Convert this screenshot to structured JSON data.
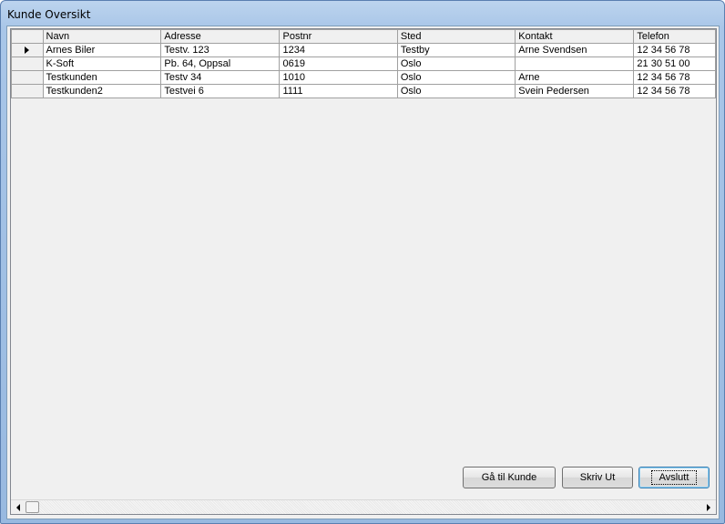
{
  "window": {
    "title": "Kunde Oversikt"
  },
  "grid": {
    "columns": [
      "Navn",
      "Adresse",
      "Postnr",
      "Sted",
      "Kontakt",
      "Telefon"
    ],
    "rows": [
      [
        "Arnes Biler",
        "Testv. 123",
        "1234",
        "Testby",
        "Arne Svendsen",
        "12 34 56 78"
      ],
      [
        "K-Soft",
        "Pb. 64, Oppsal",
        "0619",
        "Oslo",
        "",
        "21 30 51 00"
      ],
      [
        "Testkunden",
        "Testv 34",
        "1010",
        "Oslo",
        "Arne",
        "12 34 56 78"
      ],
      [
        "Testkunden2",
        "Testvei 6",
        "1111",
        "Oslo",
        "Svein Pedersen",
        "12 34 56 78"
      ]
    ],
    "current_row": 0
  },
  "buttons": {
    "goto_customer": "Gå til Kunde",
    "print": "Skriv Ut",
    "close": "Avslutt"
  },
  "icons": {
    "current_row": "row-pointer-icon",
    "scroll_left": "scroll-left-arrow-icon",
    "scroll_right": "scroll-right-arrow-icon"
  }
}
